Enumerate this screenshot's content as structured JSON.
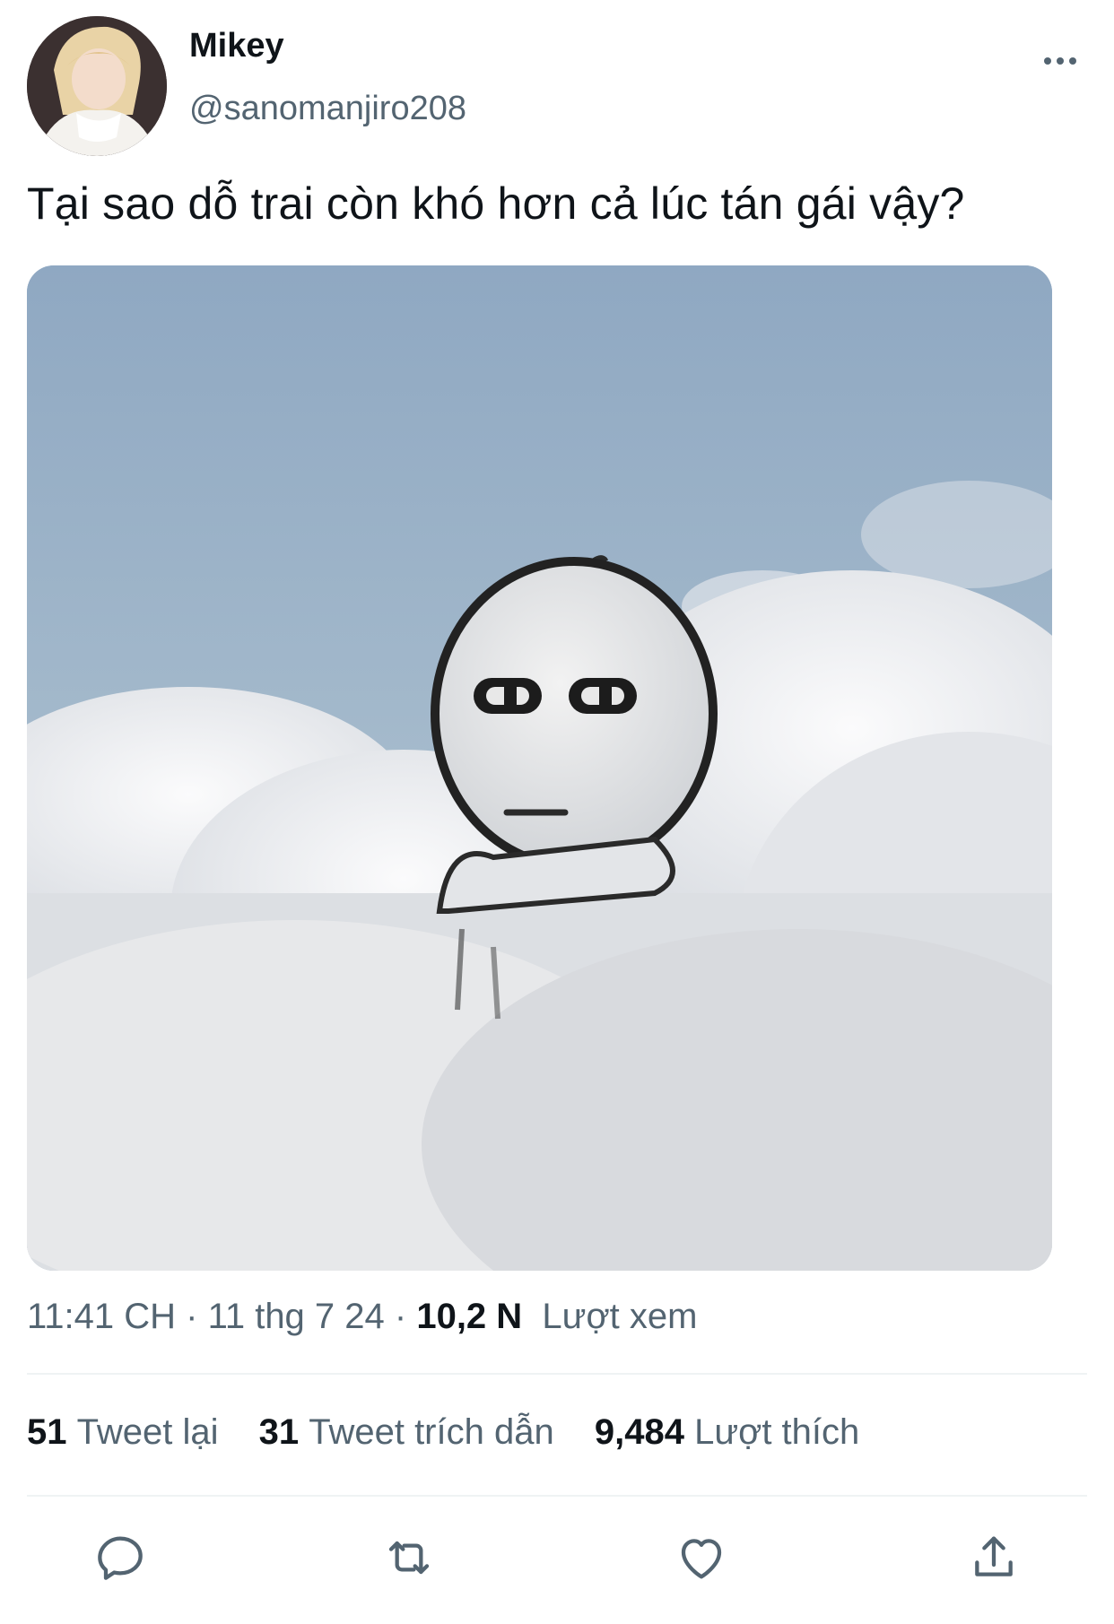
{
  "author": {
    "name": "Mikey",
    "handle": "@sanomanjiro208"
  },
  "tweet": {
    "text": "Tại sao dỗ trai còn khó hơn cả lúc tán gái vậy?"
  },
  "meta": {
    "time": "11:41 CH",
    "sep1": " · ",
    "date": "11 thg 7 24",
    "sep2": " · ",
    "views": "10,2 N",
    "views_label": "Lượt xem"
  },
  "stats": [
    {
      "count": "51",
      "label": "Tweet lại"
    },
    {
      "count": "31",
      "label": "Tweet trích dẫn"
    },
    {
      "count": "9,484",
      "label": "Lượt thích"
    }
  ],
  "actions": {
    "reply_icon": "reply-icon",
    "retweet_icon": "retweet-icon",
    "like_icon": "heart-icon",
    "share_icon": "share-icon"
  },
  "colors": {
    "text": "#0f1419",
    "secondary": "#536471",
    "divider": "#eff3f4"
  }
}
